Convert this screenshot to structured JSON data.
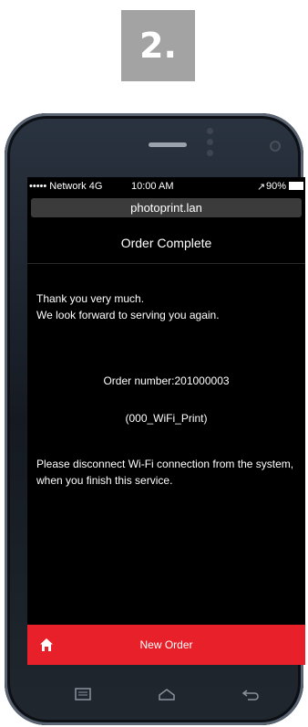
{
  "step": {
    "label": "2."
  },
  "status": {
    "carrier": "••••• Network  4G",
    "time": "10:00 AM",
    "battery": "90%",
    "location_glyph": "↗"
  },
  "browser": {
    "url": "photoprint.lan"
  },
  "page": {
    "title": "Order Complete",
    "thanks_line1": "Thank you very much.",
    "thanks_line2": "We look forward to serving you again.",
    "order_number": "Order number:201000003",
    "order_name": "(000_WiFi_Print)",
    "disconnect_note": "Please disconnect Wi-Fi connection from the system, when you finish this service."
  },
  "bottom_bar": {
    "home_icon": "home-icon",
    "new_order_label": "New Order",
    "color": "#e8202a"
  },
  "android_nav": {
    "recent_icon": "recent-apps-icon",
    "home_icon": "android-home-icon",
    "back_icon": "back-icon"
  }
}
